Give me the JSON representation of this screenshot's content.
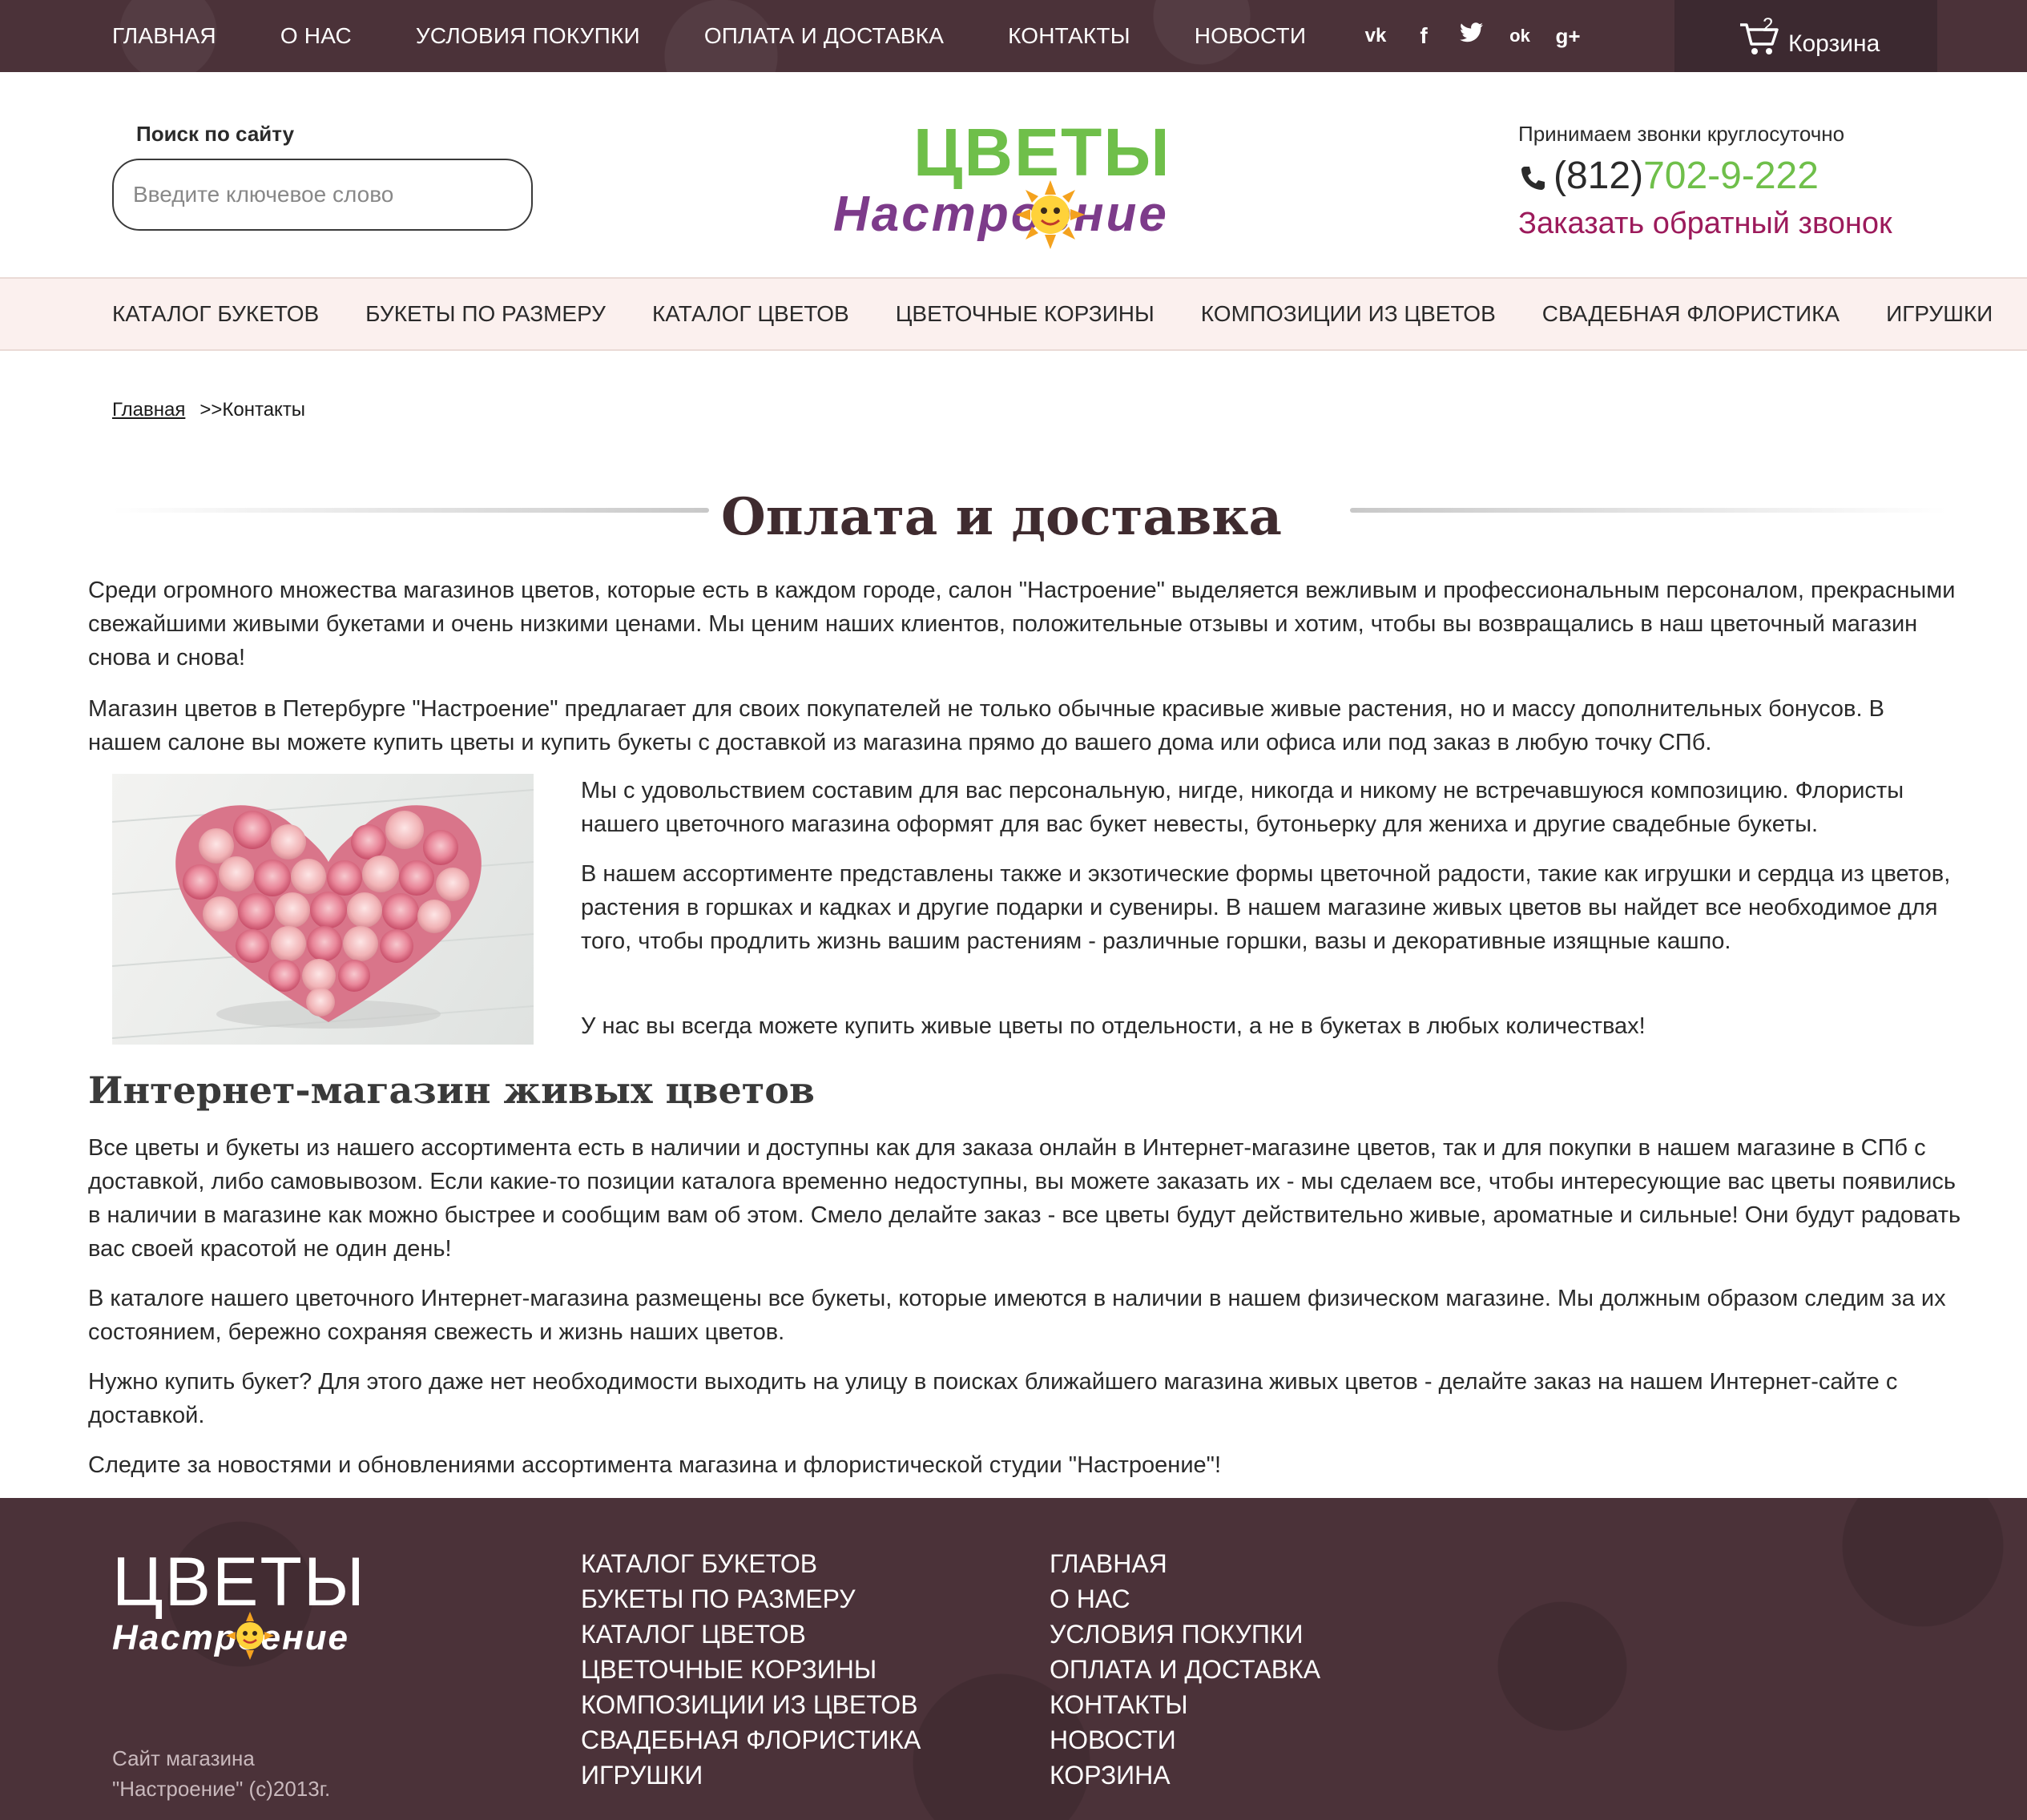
{
  "topbar": {
    "nav": [
      "ГЛАВНАЯ",
      "О НАС",
      "УСЛОВИЯ ПОКУПКИ",
      "ОПЛАТА И ДОСТАВКА",
      "КОНТАКТЫ",
      "НОВОСТИ"
    ],
    "social": [
      {
        "name": "vk-icon",
        "glyph": "vk"
      },
      {
        "name": "facebook-icon",
        "glyph": "f"
      },
      {
        "name": "twitter-icon",
        "glyph": "t"
      },
      {
        "name": "odnoklassniki-icon",
        "glyph": "ok"
      },
      {
        "name": "google-plus-icon",
        "glyph": "g+"
      }
    ],
    "cart": {
      "count": "2",
      "label": "Корзина"
    }
  },
  "header": {
    "search_title": "Поиск по сайту",
    "search_placeholder": "Введите ключевое слово",
    "logo_top": "ЦВЕТЫ",
    "logo_bottom": "Настроение",
    "phone_note": "Принимаем звонки круглосуточно",
    "phone_code": "(812)",
    "phone_number": "702-9-222",
    "callback": "Заказать обратный звонок"
  },
  "mainnav": [
    "КАТАЛОГ БУКЕТОВ",
    "БУКЕТЫ ПО РАЗМЕРУ",
    "КАТАЛОГ ЦВЕТОВ",
    "ЦВЕТОЧНЫЕ КОРЗИНЫ",
    "КОМПОЗИЦИИ ИЗ ЦВЕТОВ",
    "СВАДЕБНАЯ ФЛОРИСТИКА",
    "ИГРУШКИ"
  ],
  "breadcrumb": {
    "home": "Главная",
    "current": ">>Контакты"
  },
  "content": {
    "title": "Оплата и доставка",
    "p1": "Среди огромного множества магазинов цветов, которые есть в каждом городе, салон \"Настроение\" выделяется вежливым и профессиональным персоналом, прекрасными свежайшими живыми букетами и очень низкими ценами. Мы ценим наших клиентов, положительные отзывы и хотим, чтобы вы возвращались в наш цветочный магазин снова и снова!",
    "p2": "Магазин цветов в Петербурге \"Настроение\" предлагает для своих покупателей не только обычные красивые живые растения, но и массу дополнительных бонусов. В нашем салоне вы можете купить цветы и купить букеты с доставкой из магазина прямо до вашего дома или офиса или под заказ в любую точку СПб.",
    "p3": "Мы с удовольствием составим для вас персональную, нигде, никогда и никому не встречавшуюся композицию. Флористы нашего цветочного магазина оформят для вас букет невесты, бутоньерку для жениха и другие свадебные букеты.",
    "p4": "В нашем ассортименте представлены также и экзотические формы цветочной радости, такие как игрушки и сердца из цветов, растения в горшках и кадках и другие подарки и сувениры. В нашем магазине живых цветов вы найдет все необходимое для того, чтобы продлить жизнь вашим растениям - различные горшки, вазы и декоративные изящные кашпо.",
    "p5": "У нас вы всегда можете купить живые цветы по отдельности, а не в букетах в любых количествах!",
    "h2": "Интернет-магазин живых цветов",
    "p6": "Все цветы и букеты из нашего ассортимента есть в наличии и доступны как для заказа онлайн в Интернет-магазине цветов, так и для покупки в нашем магазине в СПб с доставкой, либо самовывозом. Если какие-то позиции каталога временно недоступны, вы можете заказать их - мы сделаем все, чтобы интересующие вас цветы появились в наличии в магазине как можно быстрее и сообщим вам об этом. Смело делайте заказ - все цветы будут действительно живые, ароматные и сильные! Они будут радовать вас своей красотой не один день!",
    "p7": "В каталоге нашего цветочного Интернет-магазина размещены все букеты, которые имеются в наличии в нашем физическом магазине. Мы должным образом следим за их состоянием, бережно сохраняя свежесть и жизнь наших цветов.",
    "p8": "Нужно купить букет? Для этого даже нет необходимости выходить на улицу в поисках ближайшего магазина живых цветов - делайте заказ на нашем Интернет-сайте с доставкой.",
    "p9": "Следите за новостями и обновлениями ассортимента магазина и флористической студии \"Настроение\"!"
  },
  "footer": {
    "logo_top": "ЦВЕТЫ",
    "logo_bottom": "Настроение",
    "copyright": "Сайт магазина \"Настроение\" (с)2013г.",
    "col1": [
      "КАТАЛОГ БУКЕТОВ",
      "БУКЕТЫ ПО РАЗМЕРУ",
      "КАТАЛОГ ЦВЕТОВ",
      "ЦВЕТОЧНЫЕ КОРЗИНЫ",
      "КОМПОЗИЦИИ ИЗ ЦВЕТОВ",
      "СВАДЕБНАЯ ФЛОРИСТИКА",
      "ИГРУШКИ"
    ],
    "col2": [
      "ГЛАВНАЯ",
      "О НАС",
      "УСЛОВИЯ ПОКУПКИ",
      "ОПЛАТА И ДОСТАВКА",
      "КОНТАКТЫ",
      "НОВОСТИ",
      "КОРЗИНА"
    ]
  },
  "colors": {
    "topbar_bg": "#4b3239",
    "brand_green": "#6fbf4a",
    "brand_purple": "#7d3b8a",
    "callback": "#9c1a5b",
    "nav_bg": "#fbf0ee"
  }
}
